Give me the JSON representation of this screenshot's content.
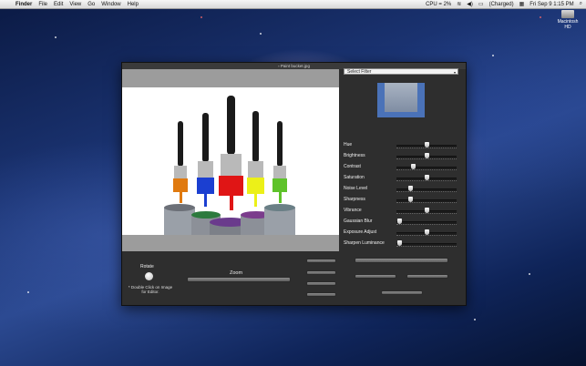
{
  "menubar": {
    "app_name": "Finder",
    "items": [
      "File",
      "Edit",
      "View",
      "Go",
      "Window",
      "Help"
    ],
    "status": {
      "cpu": "CPU = 2%",
      "battery": "(Charged)",
      "datetime": "Fri Sep 9  1:15 PM"
    }
  },
  "desktop": {
    "drive_label": "Macintosh HD"
  },
  "window": {
    "title": "Paint bucket.jpg",
    "filter_select": {
      "selected": "Select Filter"
    },
    "adjustments": [
      {
        "label": "Hue",
        "value": 0.5
      },
      {
        "label": "Brightness",
        "value": 0.5
      },
      {
        "label": "Contrast",
        "value": 0.27
      },
      {
        "label": "Saturation",
        "value": 0.5
      },
      {
        "label": "Noise Level",
        "value": 0.22
      },
      {
        "label": "Sharpness",
        "value": 0.22
      },
      {
        "label": "Vibrance",
        "value": 0.5
      },
      {
        "label": "Gaussian Blur",
        "value": 0.02
      },
      {
        "label": "Exposure Adjust",
        "value": 0.5
      },
      {
        "label": "Sharpen Luminance",
        "value": 0.02
      }
    ],
    "rotate_label": "Rotate",
    "hint": "* Double Click on Image for Editor.",
    "zoom_label": "Zoom",
    "zoom_level": 0.5
  },
  "colors": {
    "brush_colors": [
      "#e07a10",
      "#1b3fd1",
      "#e01515",
      "#ecf018",
      "#5ec22a"
    ],
    "preview_bg": "#4a72b8"
  }
}
